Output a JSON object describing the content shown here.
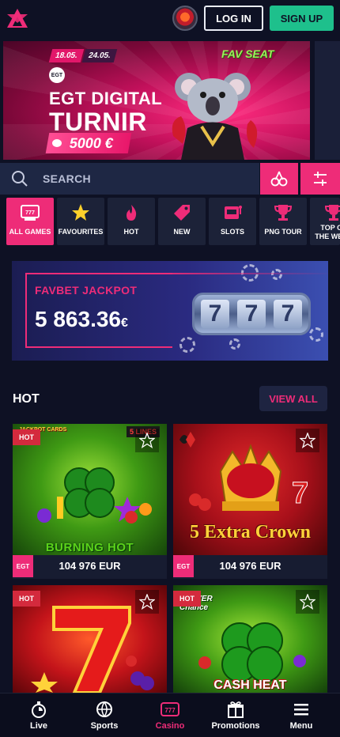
{
  "header": {
    "login_label": "LOG IN",
    "signup_label": "SIGN UP"
  },
  "banner": {
    "date_from": "18.05.",
    "date_to": "24.05.",
    "brand_small": "EGT",
    "title_line1": "EGT DIGITAL",
    "title_line2": "TURNIR",
    "prize": "5000 €",
    "game_logo": "FAV SEAT"
  },
  "search": {
    "placeholder": "SEARCH"
  },
  "categories": [
    {
      "label": "ALL GAMES",
      "icon": "all-games-icon",
      "active": true
    },
    {
      "label": "FAVOURITES",
      "icon": "star-icon",
      "active": false
    },
    {
      "label": "HOT",
      "icon": "flame-icon",
      "active": false
    },
    {
      "label": "NEW",
      "icon": "tag-icon",
      "active": false
    },
    {
      "label": "SLOTS",
      "icon": "slot-machine-icon",
      "active": false
    },
    {
      "label": "PNG TOUR",
      "icon": "trophy-icon",
      "active": false
    },
    {
      "label": "TOP OF THE WEEK",
      "icon": "trophy-icon",
      "active": false
    }
  ],
  "jackpot": {
    "label": "FAVBET JACKPOT",
    "value": "5 863.36",
    "currency": "€",
    "reels": [
      "7",
      "7",
      "7"
    ]
  },
  "hot_section": {
    "title": "HOT",
    "view_all": "VIEW ALL",
    "games": [
      {
        "title": "BURNING HOT",
        "amount": "104 976 EUR",
        "badge": "HOT",
        "corner": "5 LINES",
        "corner2": "JACKPOT CARDS"
      },
      {
        "title": "5 Extra Crown",
        "amount": "104 976 EUR",
        "badge": "",
        "corner": "",
        "corner2": ""
      },
      {
        "title": "",
        "amount": "",
        "badge": "HOT",
        "corner": "",
        "corner2": ""
      },
      {
        "title": "CASH HEAT",
        "amount": "",
        "badge": "HOT",
        "corner": "CLOVER Chance",
        "corner2": ""
      }
    ],
    "provider_badge": "EGT"
  },
  "bottom_nav": [
    {
      "label": "Live",
      "icon": "stopwatch-icon",
      "active": false
    },
    {
      "label": "Sports",
      "icon": "sports-ball-icon",
      "active": false
    },
    {
      "label": "Casino",
      "icon": "slot-777-icon",
      "active": true
    },
    {
      "label": "Promotions",
      "icon": "gift-icon",
      "active": false
    },
    {
      "label": "Menu",
      "icon": "hamburger-icon",
      "active": false
    }
  ],
  "colors": {
    "background": "#0e1124",
    "accent": "#ee2c78",
    "signup": "#1ec08c",
    "panel": "#1c2238"
  }
}
